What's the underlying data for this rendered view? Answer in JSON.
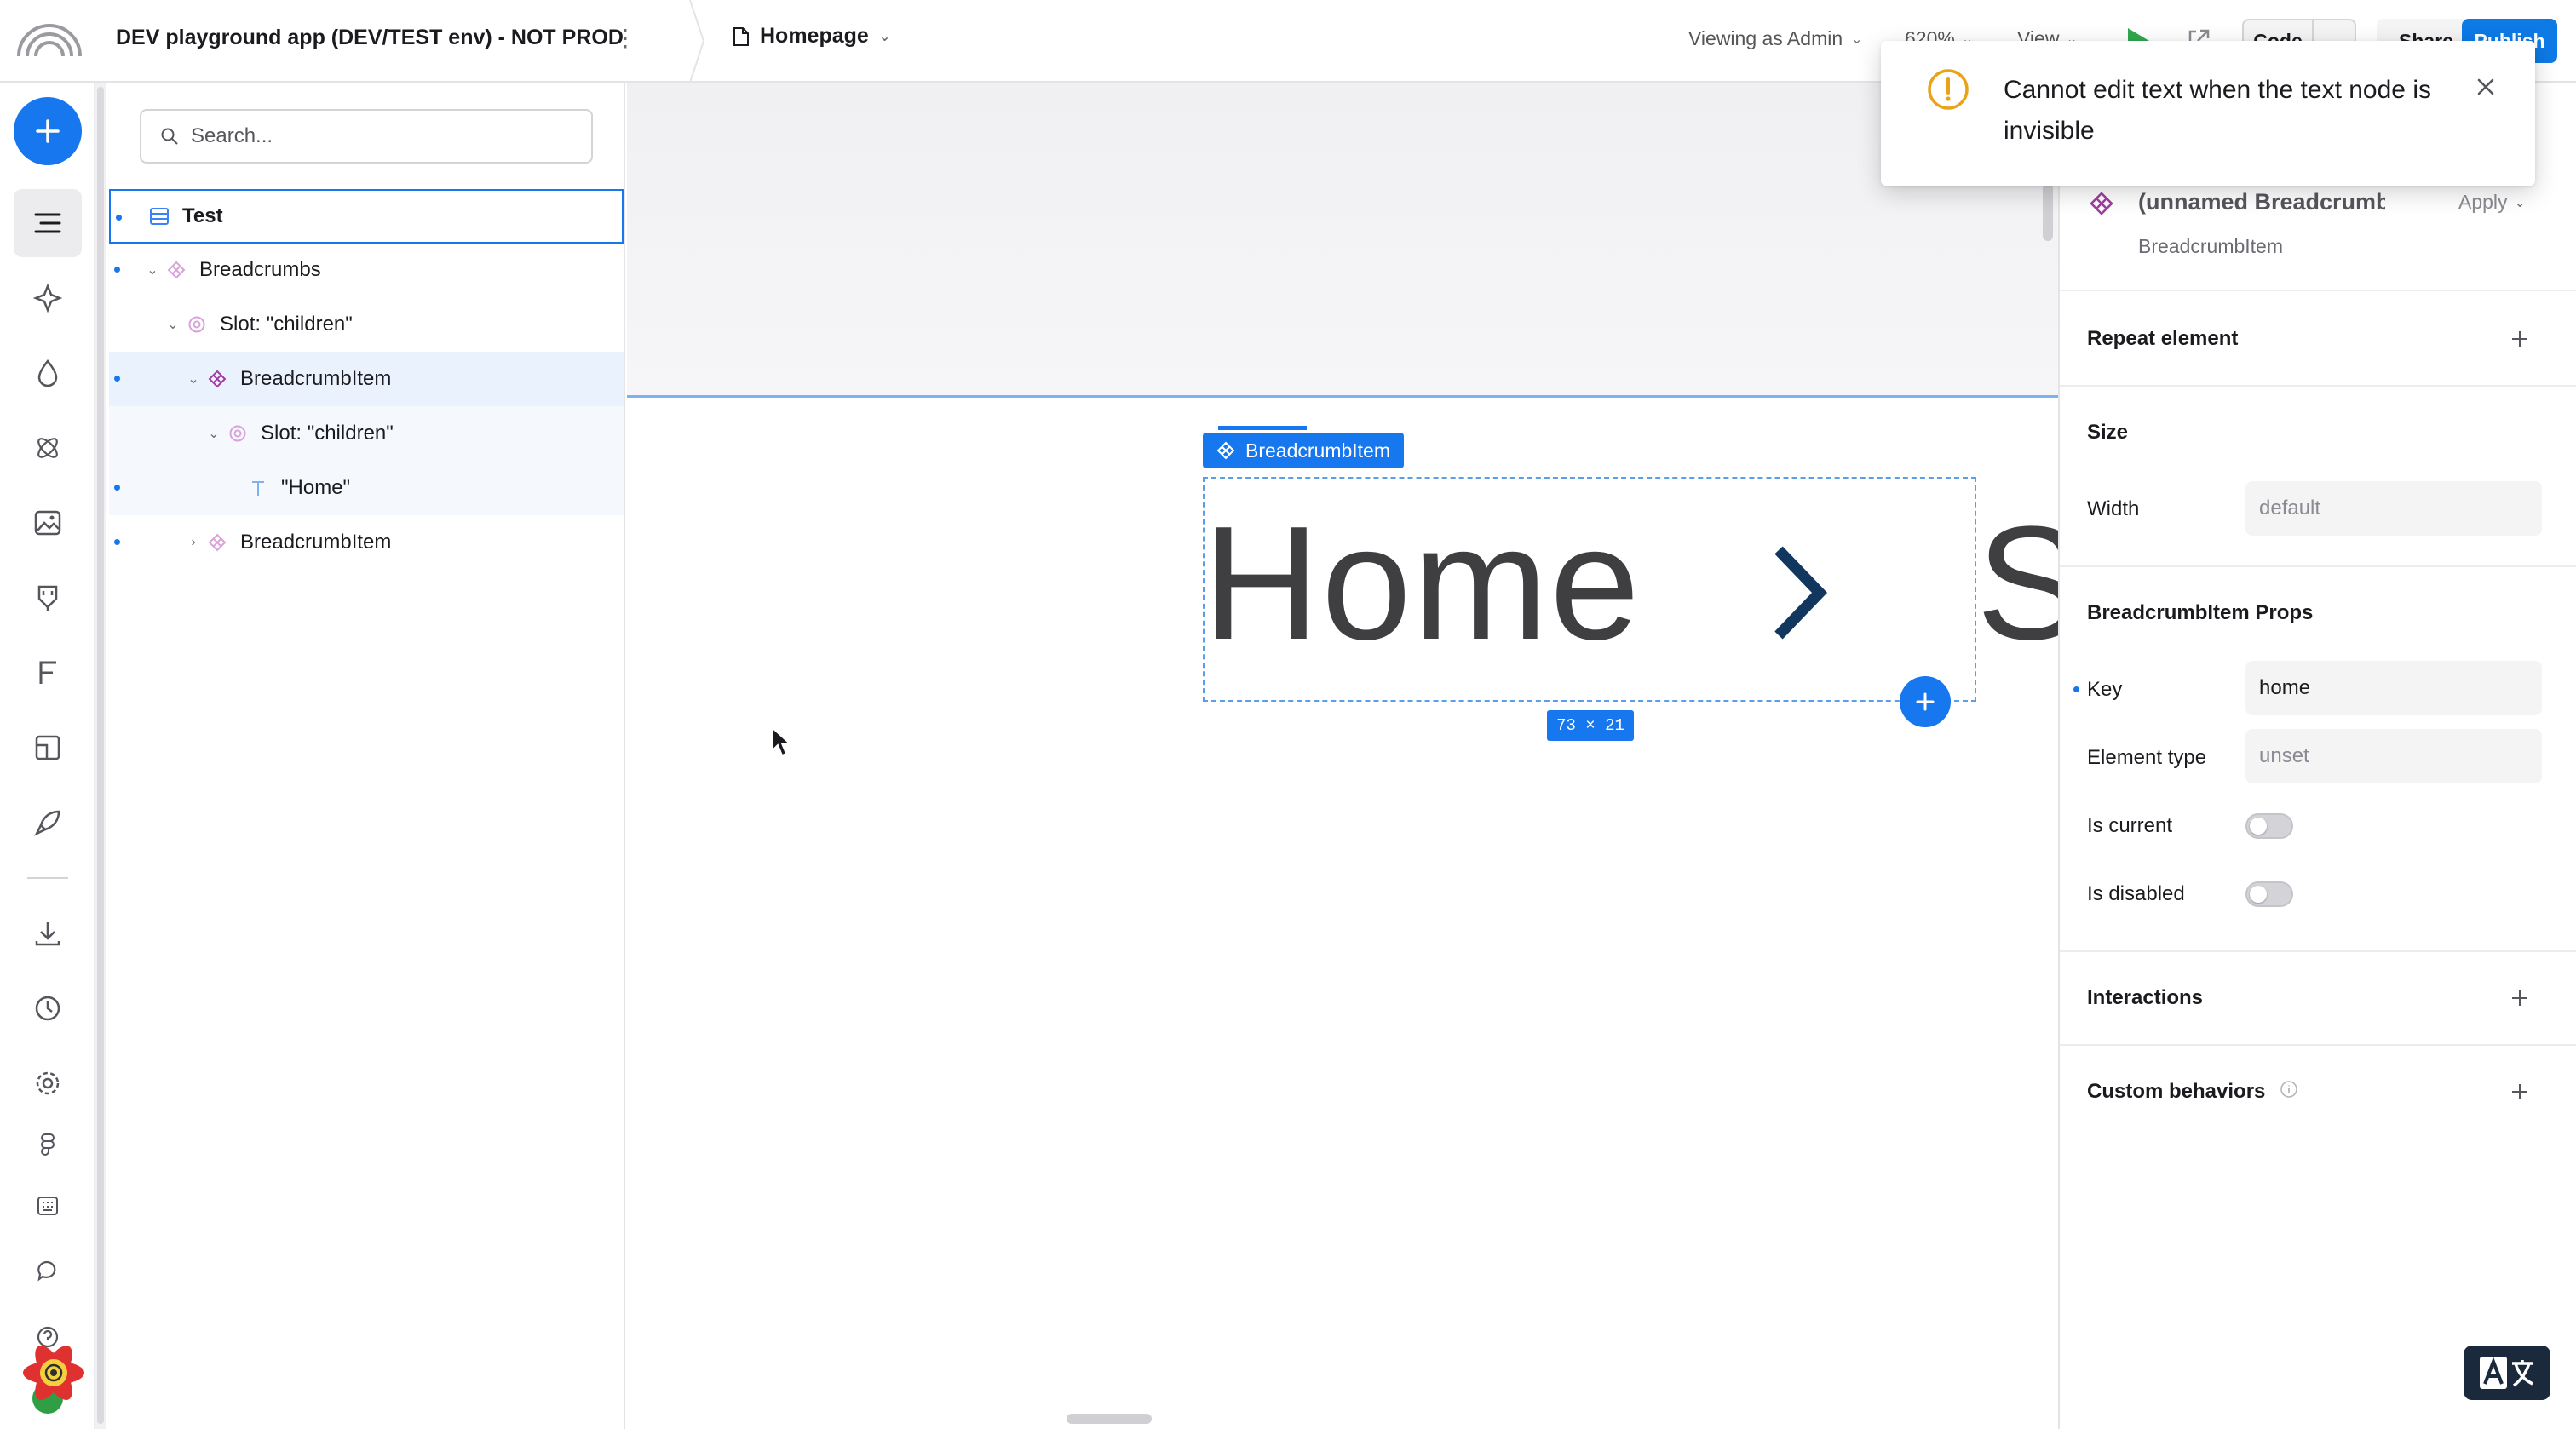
{
  "topbar": {
    "app_title": "DEV playground app (DEV/TEST env) - NOT PROD",
    "page_name": "Homepage",
    "viewing_as": "Viewing as Admin",
    "zoom": "620%",
    "view_label": "View",
    "code_label": "Code",
    "share_label": "Share",
    "publish_label": "Publish"
  },
  "rail": {
    "icons": [
      "add-icon",
      "outline-icon",
      "components-icon",
      "tokens-icon",
      "react-component-icon",
      "images-icon",
      "insert-icon",
      "fonts-icon",
      "pages-icon",
      "deploy-icon",
      "download-icon",
      "history-icon",
      "settings-icon",
      "figma-icon",
      "keyboard-icon",
      "comments-icon",
      "help-icon"
    ]
  },
  "outline": {
    "search_placeholder": "Search...",
    "items": [
      {
        "label": "Test",
        "icon": "page-icon"
      },
      {
        "label": "Breadcrumbs",
        "icon": "component-icon"
      },
      {
        "label": "Slot: \"children\"",
        "icon": "slot-icon"
      },
      {
        "label": "BreadcrumbItem",
        "icon": "component-icon"
      },
      {
        "label": "Slot: \"children\"",
        "icon": "slot-icon"
      },
      {
        "label": "\"Home\"",
        "icon": "text-icon"
      },
      {
        "label": "BreadcrumbItem",
        "icon": "component-icon"
      }
    ]
  },
  "canvas": {
    "selection_tag": "BreadcrumbItem",
    "home_text": "Home",
    "next_text": "S",
    "dimensions": "73 × 21"
  },
  "right_panel": {
    "element_name": "(unnamed BreadcrumbItem)",
    "apply_label": "Apply",
    "component_name": "BreadcrumbItem",
    "repeat_title": "Repeat element",
    "size_title": "Size",
    "width_label": "Width",
    "width_placeholder": "default",
    "props_title": "BreadcrumbItem Props",
    "key_label": "Key",
    "key_value": "home",
    "element_type_label": "Element type",
    "element_type_placeholder": "unset",
    "is_current_label": "Is current",
    "is_current": false,
    "is_disabled_label": "Is disabled",
    "is_disabled": false,
    "interactions_title": "Interactions",
    "custom_behaviors_title": "Custom behaviors"
  },
  "toast": {
    "message": "Cannot edit text when the text node is invisible"
  },
  "colors": {
    "accent": "#1677ee",
    "publish": "#0d7ae6",
    "warning": "#e8a317",
    "component_icon": "#b84db8"
  }
}
